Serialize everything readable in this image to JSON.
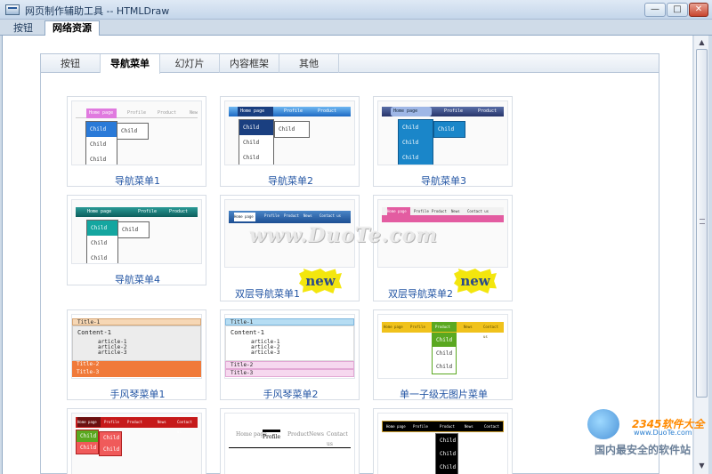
{
  "window": {
    "title": "网页制作辅助工具 -- HTMLDraw",
    "minimize": "—",
    "maximize": "□",
    "close": "✕"
  },
  "top_tabs": [
    {
      "label": "按钮"
    },
    {
      "label": "网络资源"
    }
  ],
  "inner_tabs": [
    {
      "label": "按钮"
    },
    {
      "label": "导航菜单"
    },
    {
      "label": "幻灯片"
    },
    {
      "label": "内容框架"
    },
    {
      "label": "其他"
    }
  ],
  "cards": [
    {
      "caption": "导航菜单1",
      "bar_items": [
        "Home page",
        "Profile",
        "Product",
        "New"
      ],
      "children": [
        "Child",
        "Child",
        "Child"
      ],
      "sub": "Child"
    },
    {
      "caption": "导航菜单2",
      "bar_items": [
        "Home page",
        "Profile",
        "Product"
      ],
      "children": [
        "Child",
        "Child",
        "Child"
      ],
      "sub": "Child"
    },
    {
      "caption": "导航菜单3",
      "bar_items": [
        "Home page",
        "Profile",
        "Product"
      ],
      "children": [
        "Child",
        "Child",
        "Child"
      ],
      "sub": "Child"
    },
    {
      "caption": "导航菜单4",
      "bar_items": [
        "Home page",
        "Profile",
        "Product"
      ],
      "children": [
        "Child",
        "Child",
        "Child"
      ],
      "sub": "Child"
    },
    {
      "caption": "双层导航菜单1",
      "bar_items": [
        "Home page",
        "Profile",
        "Product",
        "News",
        "Contact us"
      ],
      "badge": "new"
    },
    {
      "caption": "双层导航菜单2",
      "bar_items": [
        "Home page",
        "Profile",
        "Product",
        "News",
        "Contact us"
      ],
      "badge": "new"
    },
    {
      "caption": "手风琴菜单1",
      "rows": [
        "Title-1",
        "Content-1",
        "article-1",
        "article-2",
        "article-3",
        "Title-2",
        "Title-3"
      ]
    },
    {
      "caption": "手风琴菜单2",
      "rows": [
        "Title-1",
        "Content-1",
        "article-1",
        "article-2",
        "article-3",
        "Title-2",
        "Title-3"
      ]
    },
    {
      "caption": "单一子级无图片菜单",
      "bar_items": [
        "Home page",
        "Profile",
        "Product",
        "News",
        "Contact us"
      ],
      "children": [
        "Child",
        "Child",
        "Child"
      ]
    },
    {
      "caption": "",
      "bar_items": [
        "Home page",
        "Profile",
        "Product",
        "News",
        "Contact us"
      ],
      "children": [
        "Child",
        "Child",
        "Child",
        "Child"
      ]
    },
    {
      "caption": "",
      "bar_items": [
        "Home page",
        "Profile",
        "Product",
        "News",
        "Contact us"
      ]
    },
    {
      "caption": "",
      "bar_items": [
        "Home page",
        "Profile",
        "Product",
        "News",
        "Contact us"
      ],
      "children": [
        "Child",
        "Child",
        "Child"
      ]
    }
  ],
  "watermark": "www.DuoTe.com",
  "brand": {
    "name": "2345软件大全",
    "url": "www.DuoTe.com",
    "slogan": "国内最安全的软件站"
  },
  "colors": {
    "accent": "#2456a4",
    "badge": "#f3e60e"
  }
}
